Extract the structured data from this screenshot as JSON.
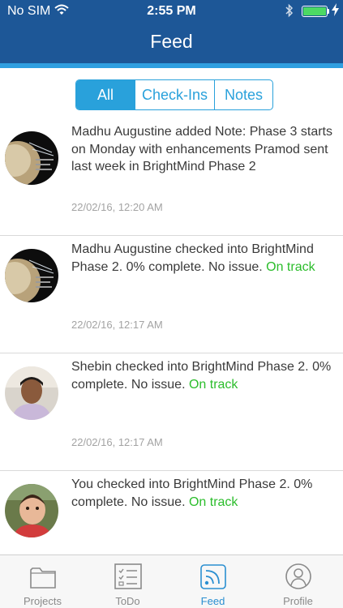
{
  "status_bar": {
    "carrier": "No SIM",
    "time": "2:55 PM",
    "battery_color": "#4cd964"
  },
  "header": {
    "title": "Feed",
    "bg_color": "#1d5797",
    "stripe_color": "#2f9fe0"
  },
  "filters": {
    "all": "All",
    "checkins": "Check-Ins",
    "notes": "Notes",
    "selected": "All"
  },
  "feed": [
    {
      "author": "Madhu Augustine",
      "text": "Madhu Augustine  added Note: Phase 3 starts on Monday with enhancements Pramod sent last week  in BrightMind Phase 2",
      "status": "",
      "timestamp": "22/02/16, 12:20 AM",
      "avatar": "planet-avatar"
    },
    {
      "author": "Madhu Augustine",
      "text": "Madhu Augustine    checked into BrightMind Phase 2. 0% complete. No issue.",
      "status": "On track",
      "timestamp": "22/02/16, 12:17 AM",
      "avatar": "planet-avatar"
    },
    {
      "author": "Shebin",
      "text": "Shebin   checked into   BrightMind Phase 2. 0% complete. No issue.",
      "status": "On track",
      "timestamp": "22/02/16, 12:17 AM",
      "avatar": "man-avatar"
    },
    {
      "author": "You",
      "text": "You   checked into   BrightMind Phase 2. 0% complete. No issue.",
      "status": "On track",
      "timestamp": "",
      "avatar": "child-avatar"
    }
  ],
  "status_color": "#2bbd2b",
  "tabbar": {
    "tabs": [
      {
        "label": "Projects",
        "icon": "folder-icon"
      },
      {
        "label": "ToDo",
        "icon": "checklist-icon"
      },
      {
        "label": "Feed",
        "icon": "feed-icon"
      },
      {
        "label": "Profile",
        "icon": "user-icon"
      }
    ],
    "active": "Feed",
    "active_color": "#2a8fd1"
  }
}
